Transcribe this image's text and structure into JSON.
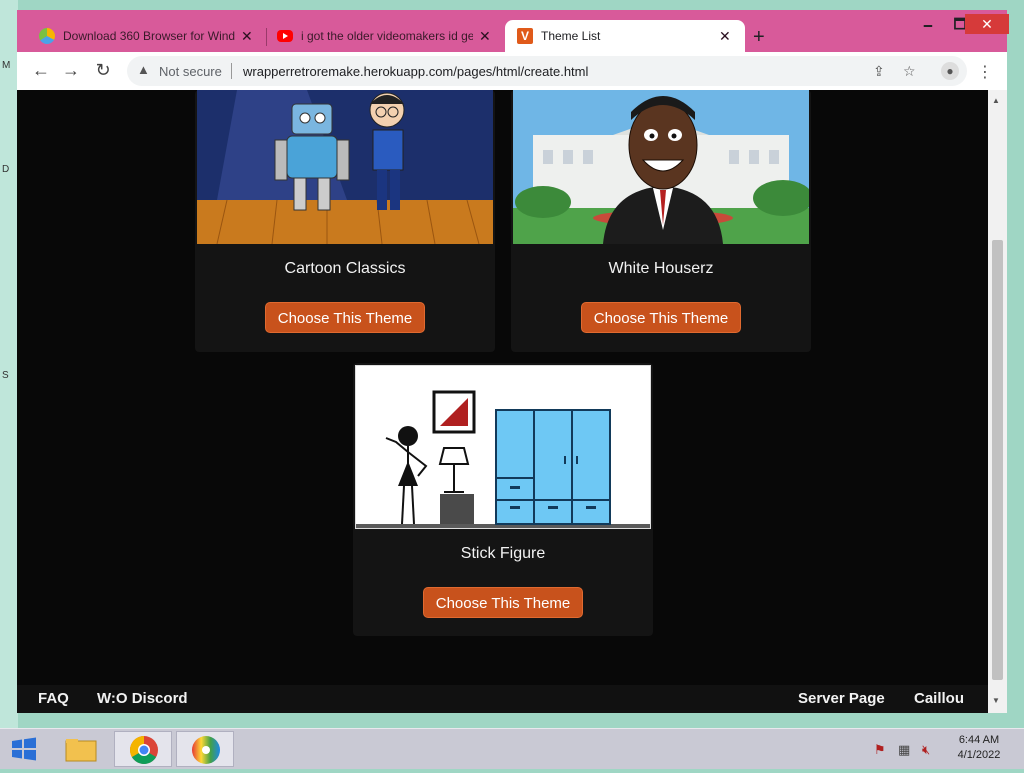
{
  "desktop": {
    "edge_labels": [
      "M",
      "D",
      "S"
    ]
  },
  "browser": {
    "tabs": [
      {
        "title": "Download 360 Browser for Wind",
        "icon": "360-browser-icon",
        "close": "✕"
      },
      {
        "title": "i got the older videomakers id ge",
        "icon": "youtube-icon",
        "close": "✕"
      },
      {
        "title": "Theme List",
        "icon": "vyond-v-icon",
        "close": "✕",
        "active": true
      }
    ],
    "new_tab": "+",
    "window_controls": {
      "minimize": "🗕",
      "maximize": "🗖",
      "close": "✕"
    },
    "address": {
      "security": "Not secure",
      "url": "wrapperretroremake.herokuapp.com/pages/html/create.html"
    }
  },
  "themes": [
    {
      "name": "Cartoon Classics",
      "button": "Choose This Theme"
    },
    {
      "name": "White Houserz",
      "button": "Choose This Theme"
    },
    {
      "name": "Stick Figure",
      "button": "Choose This Theme"
    }
  ],
  "footer": {
    "left": [
      "FAQ",
      "W:O Discord"
    ],
    "right": [
      "Server Page",
      "Caillou"
    ]
  },
  "taskbar": {
    "time": "6:44 AM",
    "date": "4/1/2022"
  },
  "colors": {
    "window_frame": "#d85a9a",
    "button": "#c8521c",
    "page_bg": "#080808",
    "card_bg": "#141414"
  }
}
